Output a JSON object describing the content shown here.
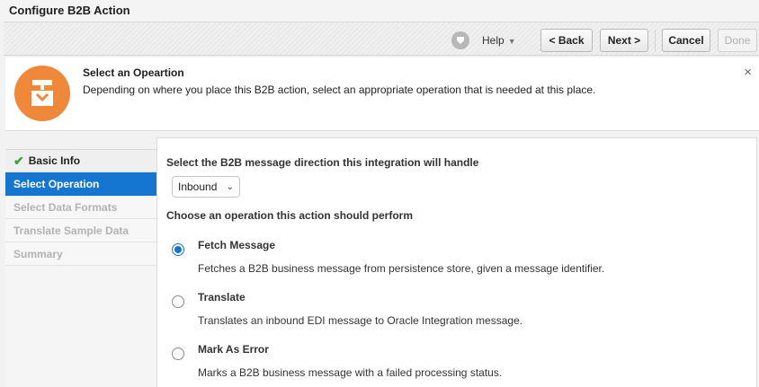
{
  "window": {
    "title": "Configure B2B Action"
  },
  "toolbar": {
    "help_label": "Help",
    "back_label": "< Back",
    "next_label": "Next >",
    "cancel_label": "Cancel",
    "done_label": "Done"
  },
  "info": {
    "title": "Select an Opeartion",
    "description": "Depending on where you place this B2B action, select an appropriate operation that is needed at this place.",
    "close_glyph": "×"
  },
  "nav": {
    "items": [
      {
        "label": "Basic Info",
        "state": "completed"
      },
      {
        "label": "Select Operation",
        "state": "active"
      },
      {
        "label": "Select Data Formats",
        "state": "disabled"
      },
      {
        "label": "Translate Sample Data",
        "state": "disabled"
      },
      {
        "label": "Summary",
        "state": "disabled"
      }
    ]
  },
  "main": {
    "direction_label": "Select the B2B message direction this integration will handle",
    "direction_value": "Inbound",
    "operation_label": "Choose an operation this action should perform",
    "options": [
      {
        "title": "Fetch Message",
        "description": "Fetches a B2B business message from persistence store, given a message identifier.",
        "selected": true
      },
      {
        "title": "Translate",
        "description": "Translates an inbound EDI message to Oracle Integration message.",
        "selected": false
      },
      {
        "title": "Mark As Error",
        "description": "Marks a B2B business message with a failed processing status.",
        "selected": false
      }
    ]
  },
  "colors": {
    "accent": "#1476d1",
    "icon_orange": "#f0883a",
    "check_green": "#3aa335"
  }
}
